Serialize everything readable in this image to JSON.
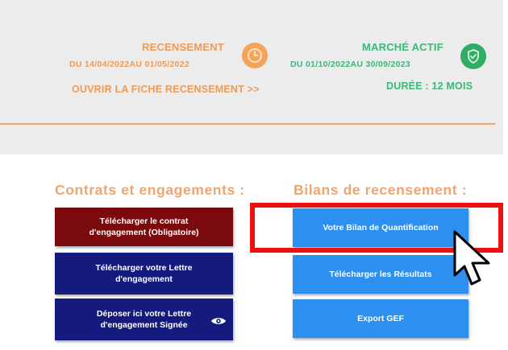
{
  "recensement": {
    "title": "RECENSEMENT",
    "dates": "DU 14/04/2022AU 01/05/2022",
    "link": "OUVRIR LA FICHE RECENSEMENT >>",
    "icon": "clock-icon",
    "color": "#ef9a55"
  },
  "marche": {
    "title": "MARCHÉ ACTIF",
    "dates": "DU 01/10/2022AU 30/09/2023",
    "duration": "DURÉE : 12 MOIS",
    "icon": "shield-check-icon",
    "color": "#3cb878"
  },
  "contrats": {
    "heading": "Contrats et engagements :",
    "buttons": [
      {
        "line1": "Télécharger le contrat",
        "line2": "d'engagement (Obligatoire)",
        "color": "#7a0a0c"
      },
      {
        "line1": "Télécharger votre Lettre",
        "line2": "d'engagement",
        "color": "#141a7e"
      },
      {
        "line1": "Déposer ici votre Lettre",
        "line2": "d'engagement Signée",
        "color": "#141a7e",
        "icon": "eye-icon"
      }
    ]
  },
  "bilans": {
    "heading": "Bilans de recensement :",
    "buttons": [
      {
        "label": "Votre Bilan de Quantification",
        "color": "#2d8ff0",
        "highlighted": true
      },
      {
        "label": "Télécharger les Résultats",
        "color": "#2d8ff0"
      },
      {
        "label": "Export GEF",
        "color": "#2d8ff0"
      }
    ]
  },
  "highlight_color": "#ee1111"
}
